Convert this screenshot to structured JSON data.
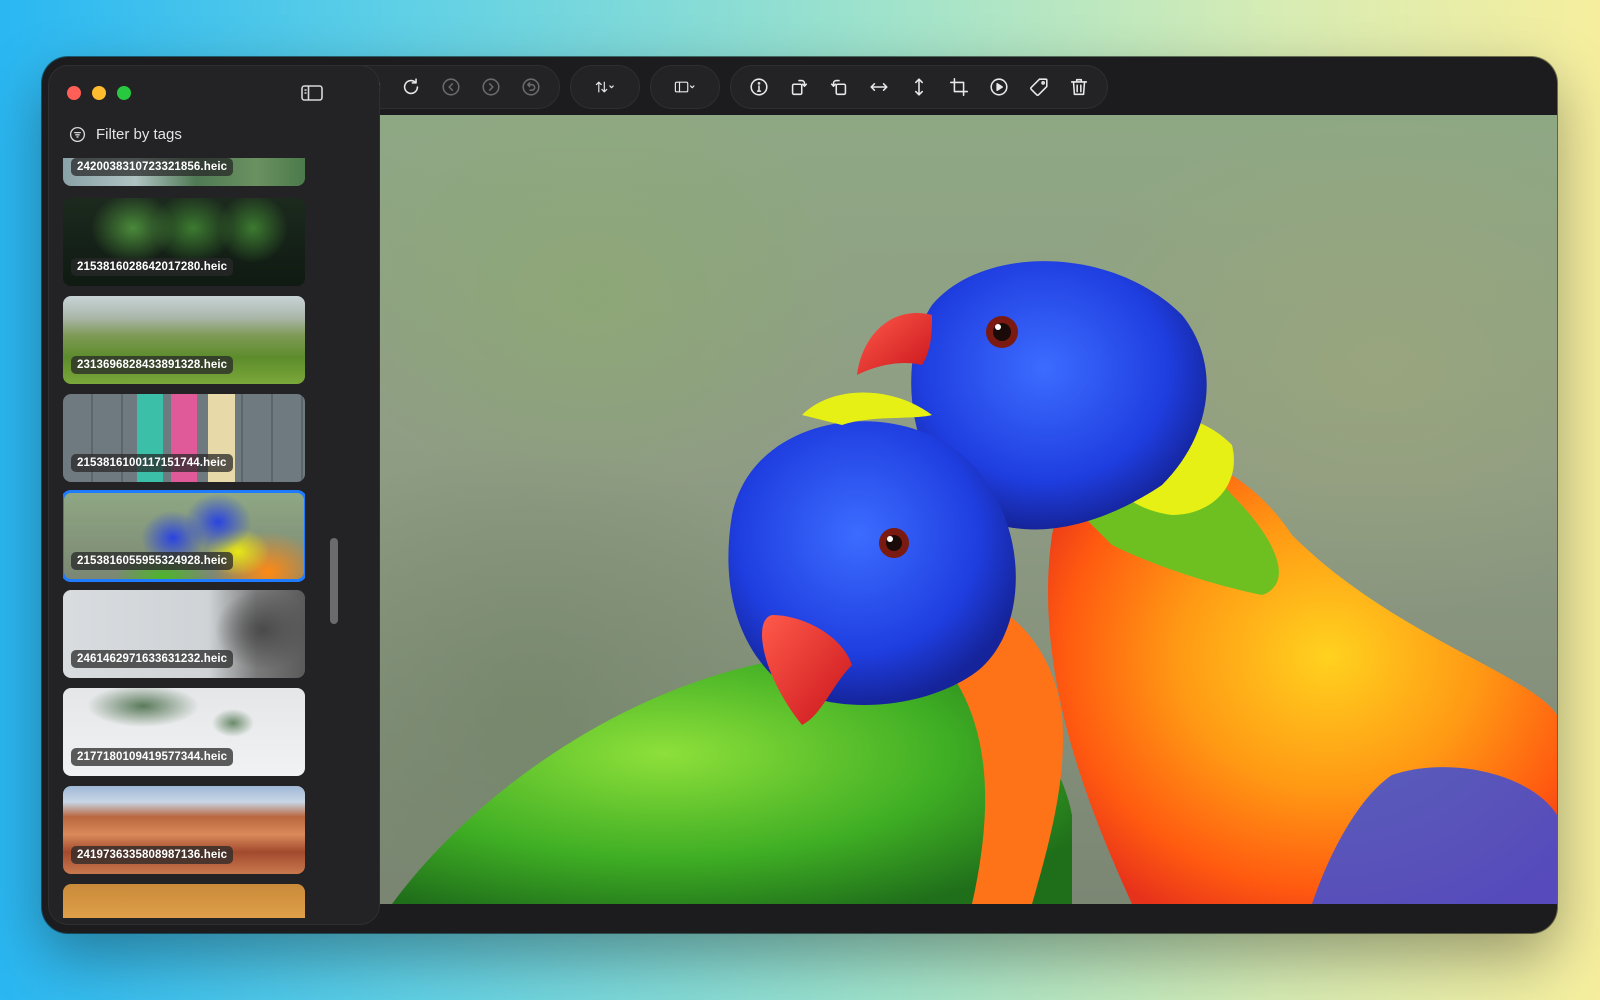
{
  "window": {
    "traffic_lights": [
      "close",
      "minimize",
      "zoom"
    ]
  },
  "sidebar": {
    "filter_label": "Filter by tags",
    "thumbnails": [
      {
        "filename": "242003831072332185​6.heic",
        "selected": false
      },
      {
        "filename": "2153816028642017280.heic",
        "selected": false
      },
      {
        "filename": "2313696828433891328.heic",
        "selected": false
      },
      {
        "filename": "2153816100117151744.heic",
        "selected": false
      },
      {
        "filename": "2153816055955324928.heic",
        "selected": true
      },
      {
        "filename": "2461462971633631232.heic",
        "selected": false
      },
      {
        "filename": "2177180109419577344.heic",
        "selected": false
      },
      {
        "filename": "2419736335808987136.heic",
        "selected": false
      }
    ]
  },
  "toolbar": {
    "groups": [
      [
        "folder-icon",
        "reload-icon",
        "previous-icon",
        "next-icon",
        "undo-icon"
      ],
      [
        "sort-icon"
      ],
      [
        "layout-icon"
      ],
      [
        "info-icon",
        "rotate-left-icon",
        "rotate-right-icon",
        "flip-horizontal-icon",
        "flip-vertical-icon",
        "crop-icon",
        "play-icon",
        "tag-icon",
        "trash-icon"
      ]
    ]
  },
  "colors": {
    "accent": "#1f7bff",
    "window_bg": "#1c1c1e",
    "sidebar_bg": "#232325"
  }
}
